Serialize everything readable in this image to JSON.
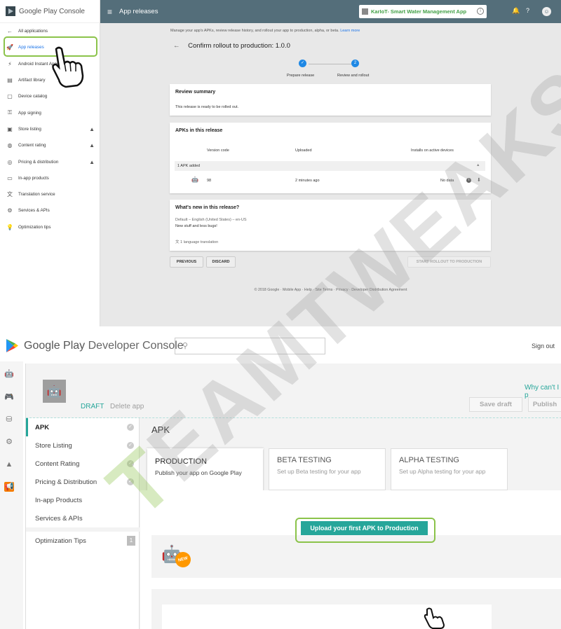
{
  "top": {
    "brand": "Google Play Console",
    "nav": [
      {
        "label": "All applications",
        "icon": "arrow-left-icon",
        "glyph": "←",
        "warn": false
      },
      {
        "label": "App releases",
        "icon": "rocket-icon",
        "glyph": "🚀",
        "warn": false,
        "active": true
      },
      {
        "label": "Android Instant Apps",
        "icon": "instant-app-icon",
        "glyph": "⚡",
        "warn": false
      },
      {
        "label": "Artifact library",
        "icon": "library-icon",
        "glyph": "▤",
        "warn": false
      },
      {
        "label": "Device catalog",
        "icon": "device-icon",
        "glyph": "▢",
        "warn": false
      },
      {
        "label": "App signing",
        "icon": "key-icon",
        "glyph": "⚿",
        "warn": false
      },
      {
        "label": "Store listing",
        "icon": "store-icon",
        "glyph": "▣",
        "warn": true
      },
      {
        "label": "Content rating",
        "icon": "rating-icon",
        "glyph": "◍",
        "warn": true
      },
      {
        "label": "Pricing & distribution",
        "icon": "globe-icon",
        "glyph": "◎",
        "warn": true
      },
      {
        "label": "In-app products",
        "icon": "card-icon",
        "glyph": "▭",
        "warn": false
      },
      {
        "label": "Translation service",
        "icon": "translate-icon",
        "glyph": "文",
        "warn": false
      },
      {
        "label": "Services & APIs",
        "icon": "services-icon",
        "glyph": "⚙",
        "warn": false
      },
      {
        "label": "Optimization tips",
        "icon": "bulb-icon",
        "glyph": "💡",
        "warn": false
      }
    ],
    "header_title": "App releases",
    "app_name": "KarIoT- Smart Water Management App",
    "intro": "Manage your app's APKs, review release history, and rollout your app to production, alpha, or beta.",
    "learn_more": "Learn more",
    "confirm_title": "Confirm rollout to production: 1.0.0",
    "steps": {
      "one": "Prepare release",
      "two": "Review and rollout",
      "two_num": "2"
    },
    "review": {
      "title": "Review summary",
      "text": "This release is ready to be rolled out."
    },
    "apks": {
      "title": "APKs in this release",
      "col_version": "Version code",
      "col_uploaded": "Uploaded",
      "col_installs": "Installs on active devices",
      "added": "1 APK added",
      "version": "98",
      "uploaded": "2 minutes ago",
      "installs": "No data"
    },
    "whats_new": {
      "title": "What's new in this release?",
      "locale": "Default – English (United States) – en-US",
      "text": "New stuff and less bugs!",
      "translation": "1 language translation"
    },
    "btn_previous": "PREVIOUS",
    "btn_discard": "DISCARD",
    "btn_start": "START ROLLOUT TO PRODUCTION",
    "footer": "© 2018 Google · Mobile App · Help · Site Terms · Privacy · Developer Distribution Agreement"
  },
  "bottom": {
    "brand_gp": "Google Play",
    "brand_dc": "Developer Console",
    "search_placeholder": "",
    "sign_out": "Sign out",
    "draft": "DRAFT",
    "delete_app": "Delete app",
    "why": "Why can't I p",
    "save_draft": "Save draft",
    "publish": "Publish",
    "menu": [
      {
        "label": "APK",
        "check": true,
        "active": true
      },
      {
        "label": "Store Listing",
        "check": true
      },
      {
        "label": "Content Rating",
        "check": true
      },
      {
        "label": "Pricing & Distribution",
        "check": true
      },
      {
        "label": "In-app Products",
        "check": false
      },
      {
        "label": "Services & APIs",
        "check": false
      }
    ],
    "optimization": "Optimization Tips",
    "optimization_count": "1",
    "apk_title": "APK",
    "tabs": [
      {
        "title": "PRODUCTION",
        "sub": "Publish your app on Google Play"
      },
      {
        "title": "BETA TESTING",
        "sub": "Set up Beta testing for your app"
      },
      {
        "title": "ALPHA TESTING",
        "sub": "Set up Alpha testing for your app"
      }
    ],
    "new_badge": "NEW",
    "upload_btn": "Upload your first APK to Production"
  },
  "watermark": {
    "t": "T",
    "rest": "EAMTWEAKS"
  },
  "colors": {
    "accent_green": "#8bc34a",
    "teal": "#26a69a",
    "header": "#546e7a"
  }
}
